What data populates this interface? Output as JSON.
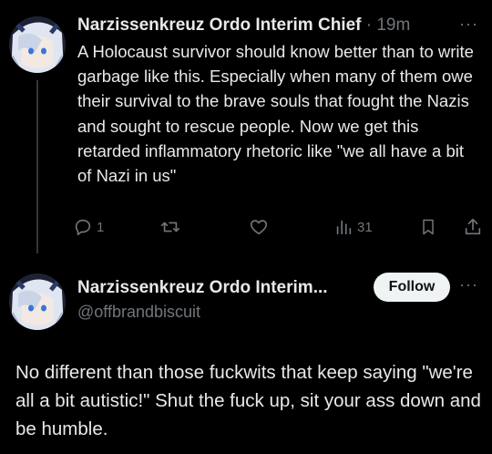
{
  "reply": {
    "author_name": "Narzissenkreuz Ordo Interim Chief",
    "separator": "·",
    "time": "19m",
    "more_label": "···",
    "text": "A Holocaust survivor should know better than to write garbage like this. Especially when many of them owe their survival to the brave souls that fought the Nazis and sought to rescue people. Now we get this retarded inflammatory rhetoric like \"we all have a bit of Nazi in us\"",
    "actions": {
      "reply_count": "1",
      "repost_count": "",
      "like_count": "",
      "views_count": "31"
    },
    "icons": [
      "reply-icon",
      "repost-icon",
      "like-icon",
      "views-icon",
      "bookmark-icon",
      "share-icon"
    ]
  },
  "quoted_post": {
    "author_name": "Narzissenkreuz Ordo Interim...",
    "handle": "@offbrandbiscuit",
    "follow_label": "Follow",
    "more_label": "···",
    "text": "No different than those fuckwits that keep saying \"we're all a bit autistic!\" Shut the fuck up, sit your ass down and be humble."
  },
  "colors": {
    "background": "#000000",
    "text": "#e7e9ea",
    "secondary_text": "#71767b",
    "follow_button_bg": "#eff3f4"
  }
}
